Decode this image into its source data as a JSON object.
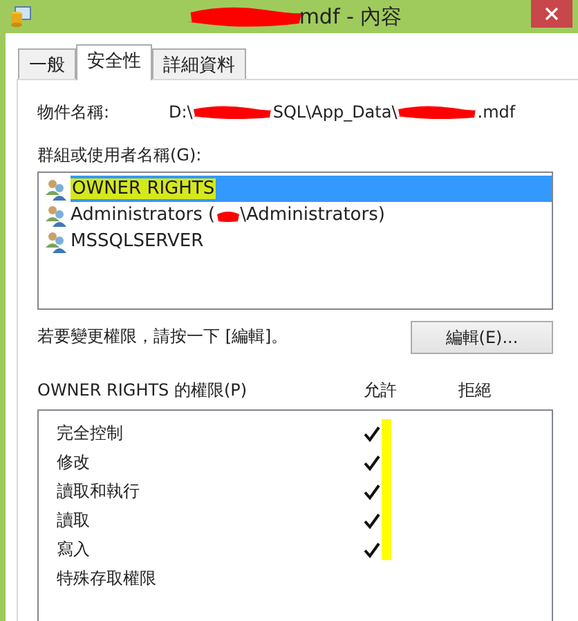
{
  "window": {
    "title_parts": [
      {
        "kind": "redaction"
      },
      {
        "kind": "text",
        "text": "mdf - 內容"
      }
    ]
  },
  "tabs": [
    {
      "label": "一般",
      "selected": false
    },
    {
      "label": "安全性",
      "selected": true
    },
    {
      "label": "詳細資料",
      "selected": false
    }
  ],
  "object_name": {
    "label": "物件名稱:",
    "parts": [
      {
        "kind": "text",
        "text": "D:\\"
      },
      {
        "kind": "redaction"
      },
      {
        "kind": "text",
        "text": "SQL\\App_Data\\"
      },
      {
        "kind": "redaction"
      },
      {
        "kind": "text",
        "text": ".mdf"
      }
    ]
  },
  "users": {
    "label": "群組或使用者名稱(G):",
    "items": [
      {
        "parts": [
          {
            "kind": "text",
            "text": "OWNER RIGHTS"
          }
        ],
        "selected": true,
        "highlighted": true
      },
      {
        "parts": [
          {
            "kind": "text",
            "text": "Administrators ("
          },
          {
            "kind": "redaction"
          },
          {
            "kind": "text",
            "text": "\\Administrators)"
          }
        ],
        "selected": false,
        "highlighted": false
      },
      {
        "parts": [
          {
            "kind": "text",
            "text": "MSSQLSERVER"
          }
        ],
        "selected": false,
        "highlighted": false
      }
    ]
  },
  "hint": "若要變更權限，請按一下 [編輯]。",
  "edit_button": "編輯(E)...",
  "permissions": {
    "label": "OWNER RIGHTS 的權限(P)",
    "allow_header": "允許",
    "deny_header": "拒絕",
    "allow_highlighted": true,
    "items": [
      {
        "name": "完全控制",
        "allow": true,
        "deny": false
      },
      {
        "name": "修改",
        "allow": true,
        "deny": false
      },
      {
        "name": "讀取和執行",
        "allow": true,
        "deny": false
      },
      {
        "name": "讀取",
        "allow": true,
        "deny": false
      },
      {
        "name": "寫入",
        "allow": true,
        "deny": false
      },
      {
        "name": "特殊存取權限",
        "allow": false,
        "deny": false
      }
    ]
  }
}
